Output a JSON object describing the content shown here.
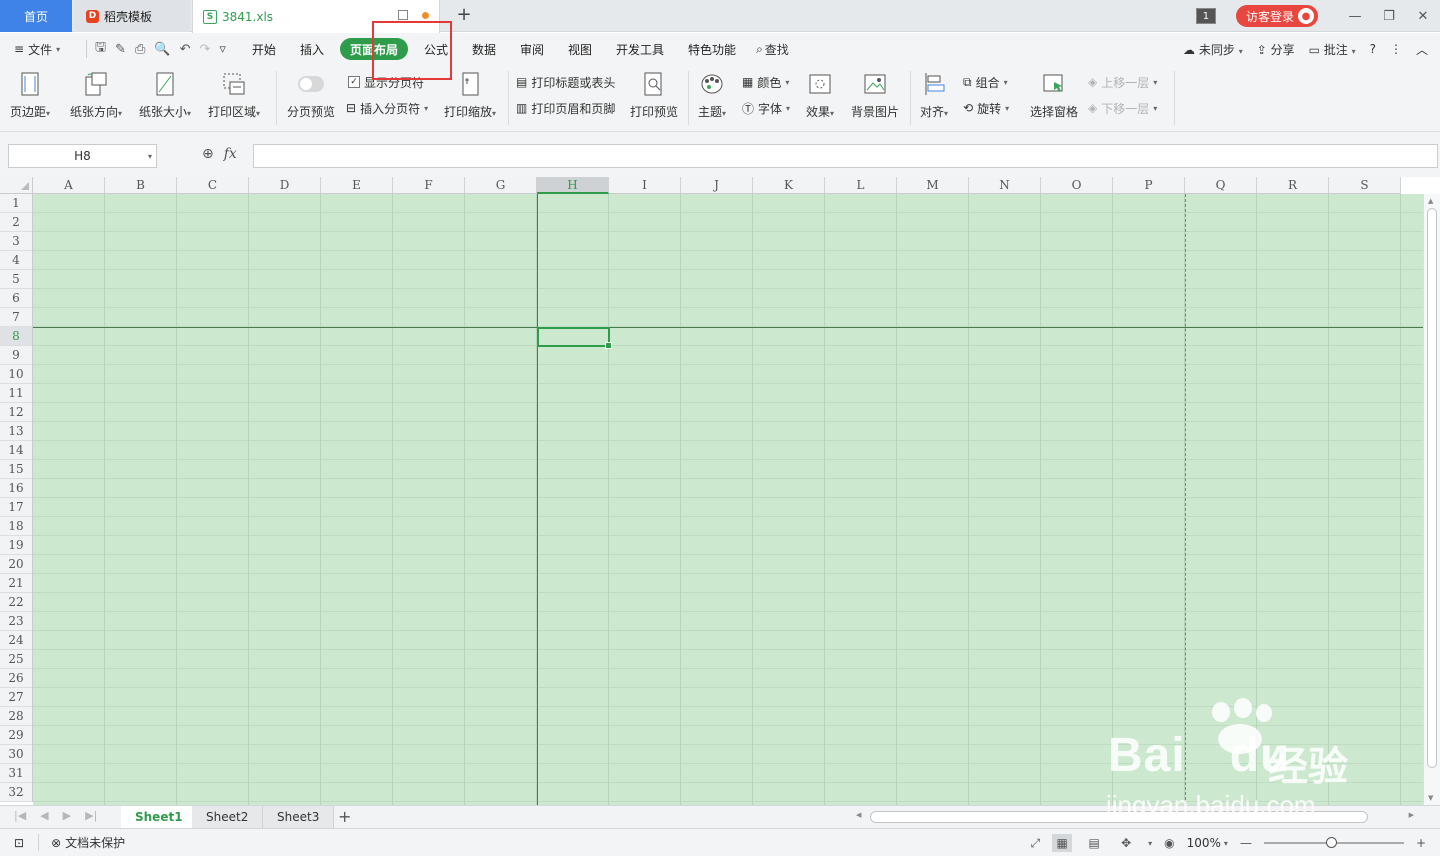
{
  "tabs": {
    "home": "首页",
    "templates": "稻壳模板",
    "file": "3841.xls",
    "window_count": "1",
    "login": "访客登录"
  },
  "menu": {
    "file": "文件",
    "tabs": [
      "开始",
      "插入",
      "页面布局",
      "公式",
      "数据",
      "审阅",
      "视图",
      "开发工具",
      "特色功能"
    ],
    "find": "查找",
    "sync": "未同步",
    "share": "分享",
    "comment": "批注",
    "help": "?"
  },
  "ribbon": {
    "margins": "页边距",
    "orientation": "纸张方向",
    "size": "纸张大小",
    "print_area": "打印区域",
    "page_preview": "分页预览",
    "show_breaks": "显示分页符",
    "insert_break": "插入分页符",
    "print_scale": "打印缩放",
    "print_titles": "打印标题或表头",
    "header_footer": "打印页眉和页脚",
    "print_preview": "打印预览",
    "theme": "主题",
    "colors": "颜色",
    "fonts": "字体",
    "effects": "效果",
    "background": "背景图片",
    "align": "对齐",
    "group": "组合",
    "rotate": "旋转",
    "selection_pane": "选择窗格",
    "bring_forward": "上移一层",
    "send_backward": "下移一层"
  },
  "formula": {
    "name_box": "H8",
    "fx": "fx",
    "value": ""
  },
  "grid": {
    "columns": [
      "A",
      "B",
      "C",
      "D",
      "E",
      "F",
      "G",
      "H",
      "I",
      "J",
      "K",
      "L",
      "M",
      "N",
      "O",
      "P",
      "Q",
      "R",
      "S"
    ],
    "rows": [
      "1",
      "2",
      "3",
      "4",
      "5",
      "6",
      "7",
      "8",
      "9",
      "10",
      "11",
      "12",
      "13",
      "14",
      "15",
      "16",
      "17",
      "18",
      "19",
      "20",
      "21",
      "22",
      "23",
      "24",
      "25",
      "26",
      "27",
      "28",
      "29",
      "30",
      "31",
      "32"
    ],
    "selected_col": "H",
    "selected_row": "8"
  },
  "sheets": [
    "Sheet1",
    "Sheet2",
    "Sheet3"
  ],
  "active_sheet": "Sheet1",
  "status": {
    "protection": "文档未保护",
    "zoom": "100%"
  },
  "watermark": {
    "brand": "Bai",
    "brand2": "du",
    "cn": "经验",
    "url": "jingyan.baidu.com"
  },
  "colors": {
    "accent": "#2f9c4b",
    "home_tab": "#3f83e8",
    "login": "#e8463e",
    "highlight": "#e53935",
    "cell_bg": "#cce8cf"
  }
}
